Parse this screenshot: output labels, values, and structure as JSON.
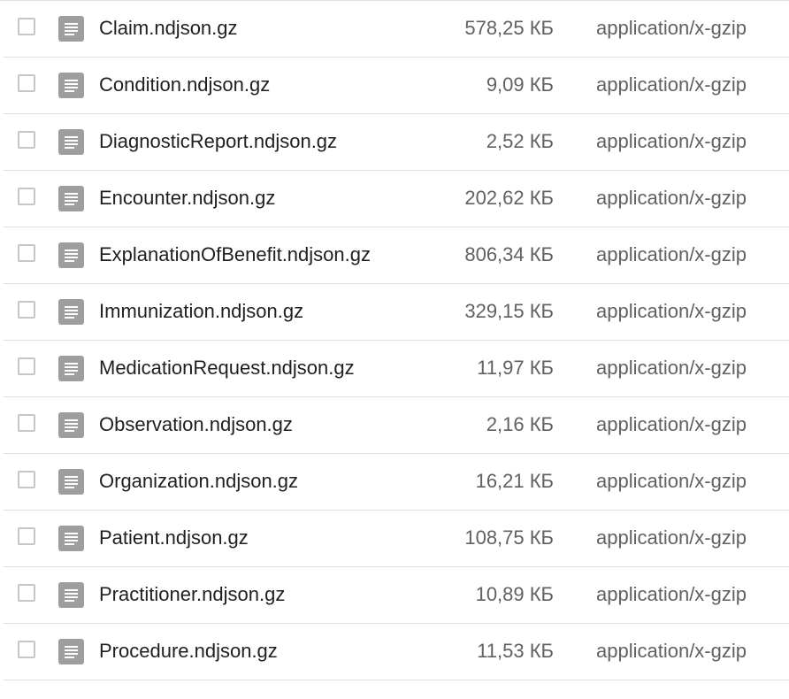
{
  "files": [
    {
      "name": "Claim.ndjson.gz",
      "size": "578,25 КБ",
      "type": "application/x-gzip"
    },
    {
      "name": "Condition.ndjson.gz",
      "size": "9,09 КБ",
      "type": "application/x-gzip"
    },
    {
      "name": "DiagnosticReport.ndjson.gz",
      "size": "2,52 КБ",
      "type": "application/x-gzip"
    },
    {
      "name": "Encounter.ndjson.gz",
      "size": "202,62 КБ",
      "type": "application/x-gzip"
    },
    {
      "name": "ExplanationOfBenefit.ndjson.gz",
      "size": "806,34 КБ",
      "type": "application/x-gzip"
    },
    {
      "name": "Immunization.ndjson.gz",
      "size": "329,15 КБ",
      "type": "application/x-gzip"
    },
    {
      "name": "MedicationRequest.ndjson.gz",
      "size": "11,97 КБ",
      "type": "application/x-gzip"
    },
    {
      "name": "Observation.ndjson.gz",
      "size": "2,16 КБ",
      "type": "application/x-gzip"
    },
    {
      "name": "Organization.ndjson.gz",
      "size": "16,21 КБ",
      "type": "application/x-gzip"
    },
    {
      "name": "Patient.ndjson.gz",
      "size": "108,75 КБ",
      "type": "application/x-gzip"
    },
    {
      "name": "Practitioner.ndjson.gz",
      "size": "10,89 КБ",
      "type": "application/x-gzip"
    },
    {
      "name": "Procedure.ndjson.gz",
      "size": "11,53 КБ",
      "type": "application/x-gzip"
    }
  ],
  "icons": {
    "file": "file-document-icon"
  },
  "colors": {
    "icon": "#9e9e9e",
    "divider": "#e0e0e0",
    "checkbox_border": "#c6c6c6",
    "name_text": "#1f1f1f",
    "meta_text": "#616161"
  }
}
